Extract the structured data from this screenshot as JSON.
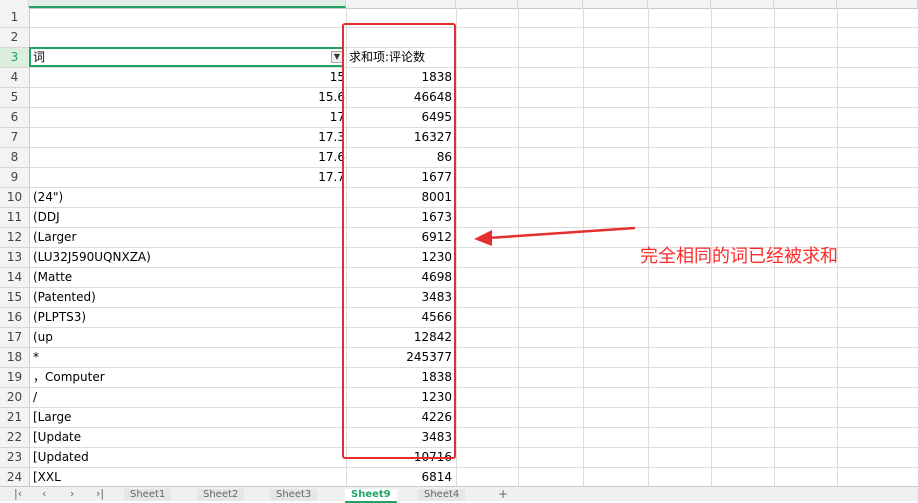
{
  "table": {
    "header_a": "词",
    "header_b": "求和项:评论数",
    "rows": [
      {
        "a": "15",
        "b": "1838",
        "num": true
      },
      {
        "a": "15.6",
        "b": "46648",
        "num": true
      },
      {
        "a": "17",
        "b": "6495",
        "num": true
      },
      {
        "a": "17.3",
        "b": "16327",
        "num": true
      },
      {
        "a": "17.6",
        "b": "86",
        "num": true
      },
      {
        "a": "17.7",
        "b": "1677",
        "num": true
      },
      {
        "a": "(24\")",
        "b": "8001"
      },
      {
        "a": "(DDJ",
        "b": "1673"
      },
      {
        "a": "(Larger",
        "b": "6912"
      },
      {
        "a": "(LU32J590UQNXZA)",
        "b": "1230"
      },
      {
        "a": "(Matte",
        "b": "4698"
      },
      {
        "a": "(Patented)",
        "b": "3483"
      },
      {
        "a": "(PLPTS3)",
        "b": "4566"
      },
      {
        "a": "(up",
        "b": "12842"
      },
      {
        "a": "*",
        "b": "245377"
      },
      {
        "a": "，Computer",
        "b": "1838"
      },
      {
        "a": "/",
        "b": "1230"
      },
      {
        "a": "[Large",
        "b": "4226"
      },
      {
        "a": "[Update",
        "b": "3483"
      },
      {
        "a": "[Updated",
        "b": "10716"
      },
      {
        "a": "[XXL",
        "b": "6814"
      }
    ]
  },
  "row_numbers": [
    "1",
    "2",
    "3",
    "4",
    "5",
    "6",
    "7",
    "8",
    "9",
    "10",
    "11",
    "12",
    "13",
    "14",
    "15",
    "16",
    "17",
    "18",
    "19",
    "20",
    "21",
    "22",
    "23",
    "24"
  ],
  "annotation": "完全相同的词已经被求和",
  "sheets": [
    "Sheet1",
    "Sheet2",
    "Sheet3",
    "Sheet9",
    "Sheet4"
  ],
  "active_sheet": "Sheet9",
  "colors": {
    "accent": "#21a366",
    "annotation": "#ff2a2a"
  }
}
